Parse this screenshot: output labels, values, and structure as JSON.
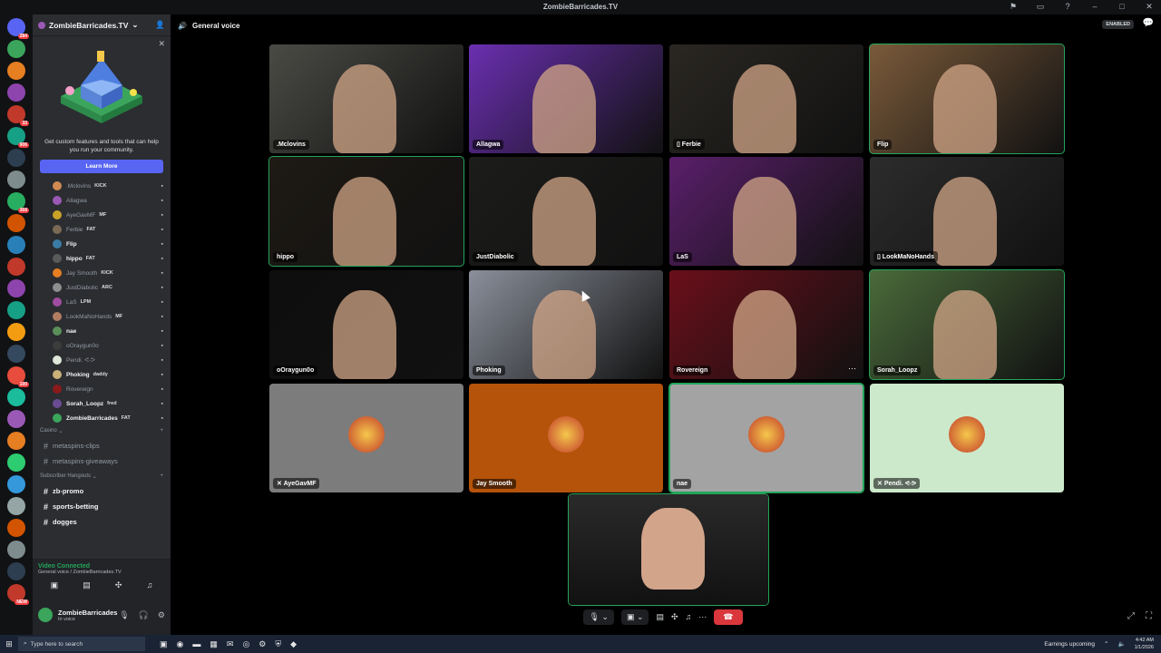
{
  "window": {
    "title": "ZombieBarricades.TV"
  },
  "guild_badges": [
    "284",
    "",
    "",
    "",
    "33",
    "906",
    "",
    "",
    "368",
    "",
    "",
    "",
    "",
    "",
    "",
    "",
    "100",
    "",
    "",
    "",
    "",
    "",
    "",
    "",
    "",
    "",
    "NEW"
  ],
  "sidebar": {
    "server_name": "ZombieBarricades.TV",
    "promo": {
      "text": "Get custom features and tools that can help you run your community.",
      "button": "Learn More"
    },
    "members": [
      {
        "name": ".Mclovins",
        "tag": "KICK",
        "bold": false,
        "color": "#d08a52"
      },
      {
        "name": "Allagwa",
        "tag": "",
        "bold": false,
        "color": "#9b59b6"
      },
      {
        "name": "AyeGavMF",
        "tag": "MF",
        "bold": false,
        "color": "#c9a227"
      },
      {
        "name": "Ferbie",
        "tag": "FAT",
        "bold": false,
        "color": "#7a6a55"
      },
      {
        "name": "Flip",
        "tag": "",
        "bold": true,
        "color": "#3a7ca5"
      },
      {
        "name": "hippo",
        "tag": "FAT",
        "bold": true,
        "color": "#5a5a5a"
      },
      {
        "name": "Jay Smooth",
        "tag": "KICK",
        "bold": false,
        "color": "#e67e22"
      },
      {
        "name": "JustDiabolic",
        "tag": "ARC",
        "bold": false,
        "color": "#8e8e8e"
      },
      {
        "name": "LaS",
        "tag": "LPM",
        "bold": false,
        "color": "#a04ca0"
      },
      {
        "name": "LookMaNoHands",
        "tag": "MF",
        "bold": false,
        "color": "#b07d62"
      },
      {
        "name": "nae",
        "tag": "",
        "bold": true,
        "color": "#5a8f5a"
      },
      {
        "name": "oOraygun0o",
        "tag": "",
        "bold": false,
        "color": "#3c3c3c"
      },
      {
        "name": "Pendi. ᕙ-ᕗ",
        "tag": "",
        "bold": false,
        "color": "#dfe8d8"
      },
      {
        "name": "Phoking",
        "tag": "daddy",
        "bold": true,
        "color": "#c9b07a"
      },
      {
        "name": "Rovereign",
        "tag": "",
        "bold": false,
        "color": "#8b1a1a"
      },
      {
        "name": "Sorah_Loopz",
        "tag": "fred",
        "bold": true,
        "color": "#6a4c93"
      },
      {
        "name": "ZombieBarricades",
        "tag": "FAT",
        "bold": true,
        "color": "#3ba55c"
      }
    ],
    "categories": [
      {
        "name": "Casino",
        "channels": [
          "metaspins-clips",
          "metaspins-giveaways"
        ]
      },
      {
        "name": "Subscriber Hangouts",
        "channels": [
          "zb-promo",
          "sports-betting",
          "dogges"
        ]
      }
    ],
    "voice": {
      "status": "Video Connected",
      "channel": "General voice / ZombieBarricades.TV"
    },
    "user": {
      "name": "ZombieBarricades",
      "status": "In voice"
    }
  },
  "main": {
    "channel_name": "General voice",
    "enabled_label": "ENABLED",
    "tiles": [
      {
        "name": ".Mclovins",
        "prefix": "",
        "kind": "video",
        "bg": "#4a4a45"
      },
      {
        "name": "Allagwa",
        "prefix": "",
        "kind": "video",
        "bg": "#6a2fb0"
      },
      {
        "name": "Ferbie",
        "prefix": "▯",
        "kind": "video",
        "bg": "#2a2722"
      },
      {
        "name": "Flip",
        "prefix": "",
        "kind": "video",
        "bg": "#7a5a3a"
      },
      {
        "name": "hippo",
        "prefix": "",
        "kind": "video",
        "bg": "#1e1a14"
      },
      {
        "name": "JustDiabolic",
        "prefix": "",
        "kind": "video",
        "bg": "#1c1c1a"
      },
      {
        "name": "LaS",
        "prefix": "",
        "kind": "video",
        "bg": "#5a1f6a"
      },
      {
        "name": "LookMaNoHands",
        "prefix": "▯",
        "kind": "video",
        "bg": "#2c2c2c"
      },
      {
        "name": "oOraygun0o",
        "prefix": "",
        "kind": "video",
        "bg": "#0e0e0e"
      },
      {
        "name": "Phoking",
        "prefix": "",
        "kind": "video",
        "bg": "#8a8f9a"
      },
      {
        "name": "Rovereign",
        "prefix": "",
        "kind": "video",
        "bg": "#6a0f1a"
      },
      {
        "name": "Sorah_Loopz",
        "prefix": "",
        "kind": "video",
        "bg": "#4a6a3a"
      },
      {
        "name": "AyeGavMF",
        "prefix": "✕",
        "kind": "avatar",
        "bg": "#7c7c7c"
      },
      {
        "name": "Jay Smooth",
        "prefix": "",
        "kind": "avatar",
        "bg": "#b45309"
      },
      {
        "name": "nae",
        "prefix": "",
        "kind": "avatar",
        "bg": "#a3a3a3"
      },
      {
        "name": "Pendi. ᕙ-ᕗ",
        "prefix": "✕",
        "kind": "avatar",
        "bg": "#cce9cc"
      }
    ]
  },
  "taskbar": {
    "search_placeholder": "Type here to search",
    "weather": "Earnings upcoming",
    "time": "4:42 AM",
    "date": "1/1/2026"
  }
}
